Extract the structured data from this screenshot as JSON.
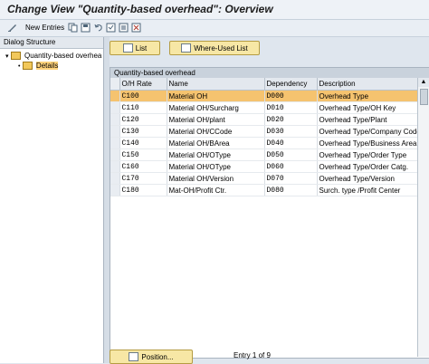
{
  "window": {
    "title": "Change View \"Quantity-based overhead\": Overview"
  },
  "toolbar": {
    "new_entries_label": "New Entries",
    "icons": [
      "edit-icon",
      "copy-icon",
      "save-icon",
      "undo-icon",
      "select-all-icon",
      "deselect-all-icon",
      "delete-icon"
    ]
  },
  "left_panel": {
    "header": "Dialog Structure",
    "tree": [
      {
        "label": "Quantity-based overhea",
        "expanded": true
      },
      {
        "label": "Details",
        "selected": true
      }
    ]
  },
  "buttons": {
    "list_label": "List",
    "where_used_label": "Where-Used List",
    "position_label": "Position..."
  },
  "table": {
    "title": "Quantity-based overhead",
    "columns": [
      "O/H Rate",
      "Name",
      "Dependency",
      "Description"
    ],
    "rows": [
      {
        "code": "C100",
        "name": "Material OH",
        "dep": "D000",
        "desc": "Overhead Type"
      },
      {
        "code": "C110",
        "name": "Material OH/Surcharg",
        "dep": "D010",
        "desc": "Overhead Type/OH Key"
      },
      {
        "code": "C120",
        "name": "Material OH/plant",
        "dep": "D020",
        "desc": "Overhead Type/Plant"
      },
      {
        "code": "C130",
        "name": "Material OH/CCode",
        "dep": "D030",
        "desc": "Overhead Type/Company Code"
      },
      {
        "code": "C140",
        "name": "Material OH/BArea",
        "dep": "D040",
        "desc": "Overhead Type/Business Area"
      },
      {
        "code": "C150",
        "name": "Material OH/OType",
        "dep": "D050",
        "desc": "Overhead Type/Order Type"
      },
      {
        "code": "C160",
        "name": "Material OH/OType",
        "dep": "D060",
        "desc": "Overhead Type/Order Catg."
      },
      {
        "code": "C170",
        "name": "Material OH/Version",
        "dep": "D070",
        "desc": "Overhead Type/Version"
      },
      {
        "code": "C180",
        "name": "Mat-OH/Profit Ctr.",
        "dep": "D080",
        "desc": "Surch. type /Profit Center"
      }
    ],
    "highlight_color": "#f5c36f"
  },
  "footer": {
    "entry_text": "Entry 1 of 9"
  },
  "colors": {
    "background": "#dfe6ee",
    "button": "#f7e7a5"
  }
}
